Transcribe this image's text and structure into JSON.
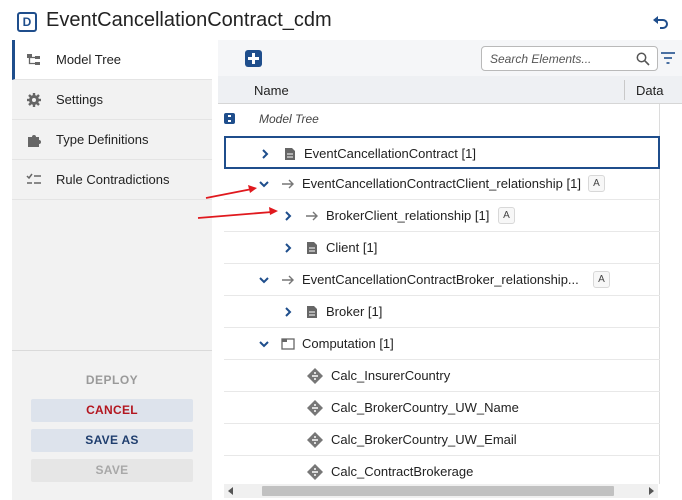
{
  "header": {
    "badge": "D",
    "title": "EventCancellationContract_cdm"
  },
  "sidebar": {
    "items": [
      {
        "label": "Model Tree",
        "icon": "model-tree-icon",
        "active": true
      },
      {
        "label": "Settings",
        "icon": "gear-icon"
      },
      {
        "label": "Type Definitions",
        "icon": "puzzle-icon"
      },
      {
        "label": "Rule Contradictions",
        "icon": "checklist-icon"
      }
    ],
    "deploy_label": "DEPLOY",
    "cancel_label": "CANCEL",
    "save_as_label": "SAVE AS",
    "save_label": "SAVE"
  },
  "toolbar": {
    "search_placeholder": "Search Elements..."
  },
  "table": {
    "columns": [
      "Name",
      "Data"
    ],
    "root_label": "Model Tree",
    "rows": [
      {
        "label": "EventCancellationContract [1]",
        "type": "entity",
        "chevron": "right",
        "selected": true
      },
      {
        "label": "EventCancellationContractClient_relationship [1]",
        "type": "relationship",
        "chevron": "down",
        "badge": "A"
      },
      {
        "label": "BrokerClient_relationship [1]",
        "type": "relationship",
        "chevron": "right",
        "badge": "A"
      },
      {
        "label": "Client [1]",
        "type": "entity",
        "chevron": "right"
      },
      {
        "label": "EventCancellationContractBroker_relationship...",
        "type": "relationship",
        "chevron": "down",
        "badge": "A"
      },
      {
        "label": "Broker [1]",
        "type": "entity",
        "chevron": "right"
      },
      {
        "label": "Computation [1]",
        "type": "folder",
        "chevron": "down"
      },
      {
        "label": "Calc_InsurerCountry",
        "type": "calc"
      },
      {
        "label": "Calc_BrokerCountry_UW_Name",
        "type": "calc"
      },
      {
        "label": "Calc_BrokerCountry_UW_Email",
        "type": "calc"
      },
      {
        "label": "Calc_ContractBrokerage",
        "type": "calc"
      }
    ]
  },
  "colors": {
    "accent": "#1f4e8c",
    "cancel": "#b3161f",
    "annotation_arrow": "#e0191e"
  }
}
